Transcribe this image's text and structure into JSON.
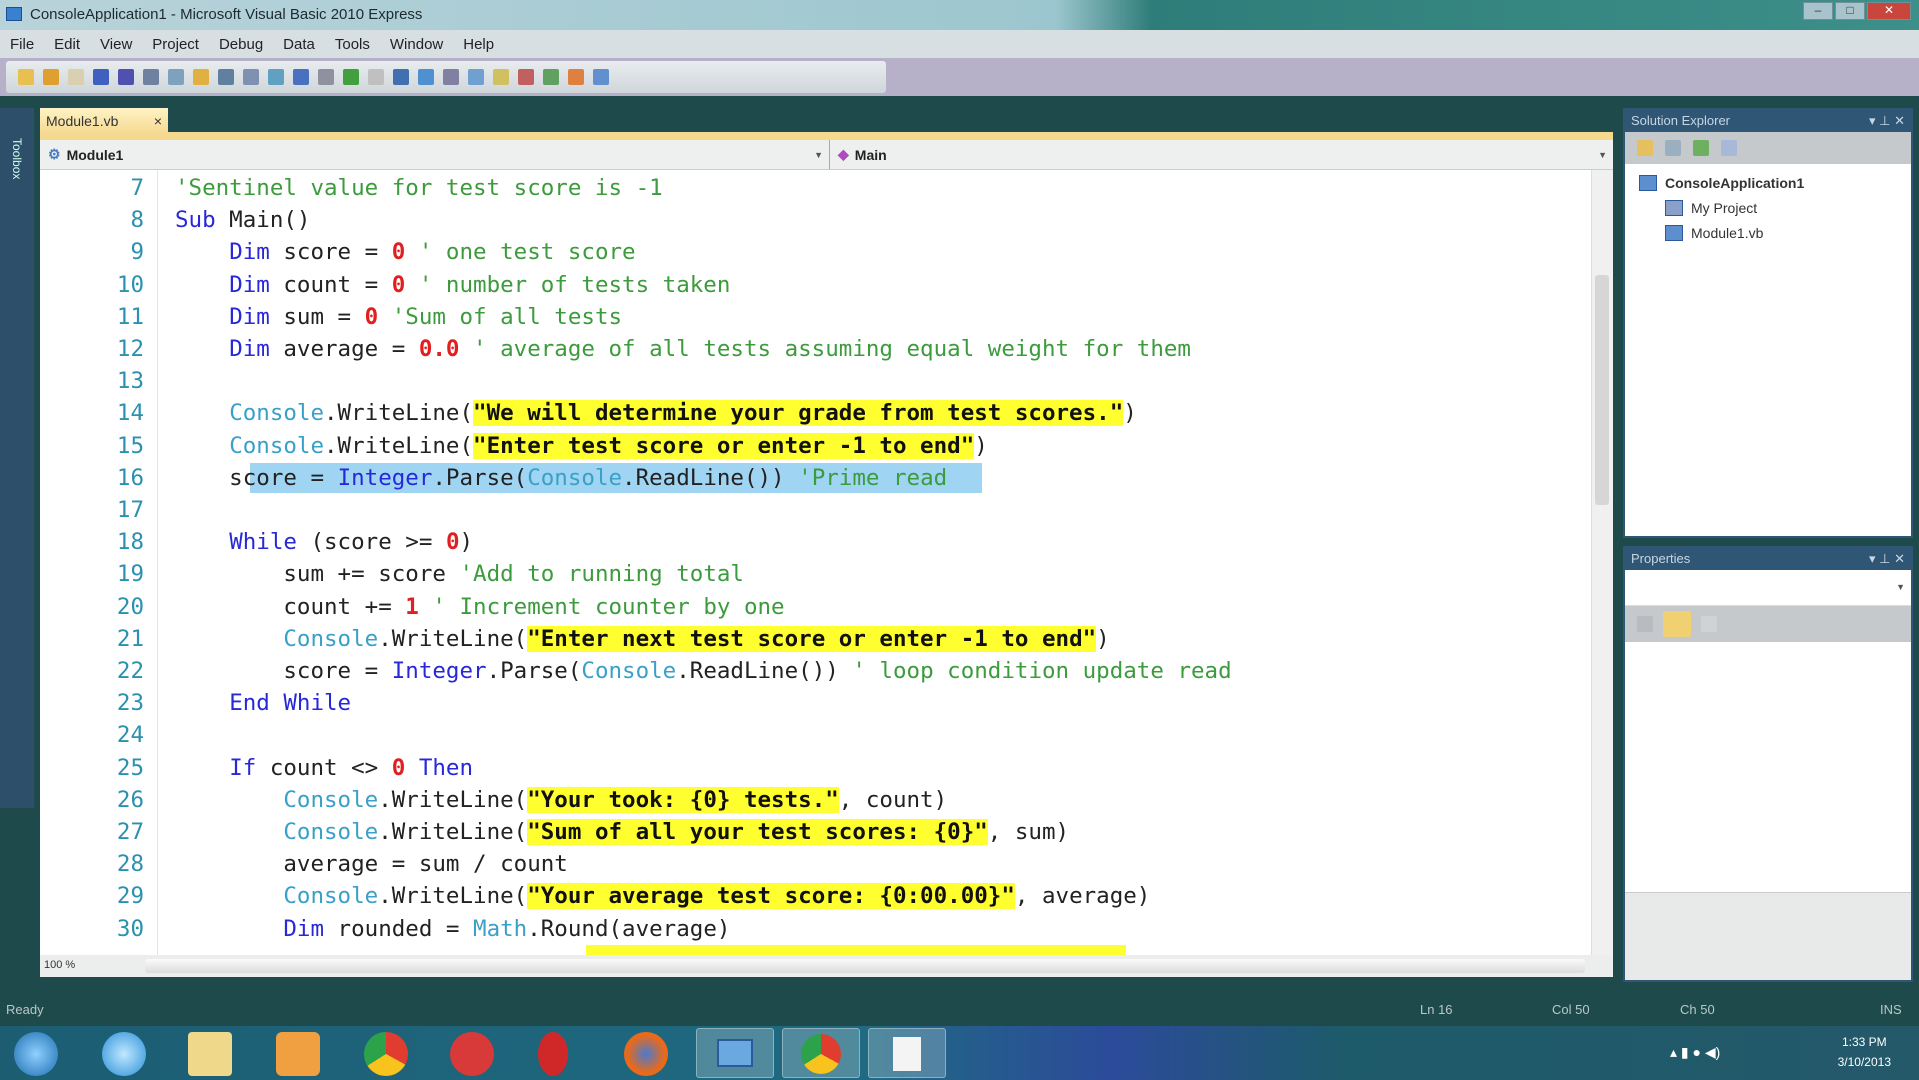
{
  "window": {
    "title": "ConsoleApplication1 - Microsoft Visual Basic 2010 Express"
  },
  "menu": [
    "File",
    "Edit",
    "View",
    "Project",
    "Debug",
    "Data",
    "Tools",
    "Window",
    "Help"
  ],
  "toolbox": {
    "label": "Toolbox"
  },
  "doc_tab": {
    "label": "Module1.vb",
    "close": "×"
  },
  "nav": {
    "left": "Module1",
    "right": "Main"
  },
  "editor": {
    "zoom": "100 %",
    "lines": [
      {
        "n": "7",
        "tokens": [
          [
            "cm",
            "'Sentinel value for test score is -1"
          ]
        ]
      },
      {
        "n": "8",
        "tokens": [
          [
            "kw",
            "Sub"
          ],
          [
            "pl",
            " Main()"
          ]
        ]
      },
      {
        "n": "9",
        "tokens": [
          [
            "pl",
            "    "
          ],
          [
            "kw",
            "Dim"
          ],
          [
            "pl",
            " score = "
          ],
          [
            "num",
            "0"
          ],
          [
            "cm",
            " ' one test score"
          ]
        ]
      },
      {
        "n": "10",
        "tokens": [
          [
            "pl",
            "    "
          ],
          [
            "kw",
            "Dim"
          ],
          [
            "pl",
            " count = "
          ],
          [
            "num",
            "0"
          ],
          [
            "cm",
            " ' number of tests taken"
          ]
        ]
      },
      {
        "n": "11",
        "tokens": [
          [
            "pl",
            "    "
          ],
          [
            "kw",
            "Dim"
          ],
          [
            "pl",
            " sum = "
          ],
          [
            "num",
            "0"
          ],
          [
            "cm",
            " 'Sum of all tests"
          ]
        ]
      },
      {
        "n": "12",
        "tokens": [
          [
            "pl",
            "    "
          ],
          [
            "kw",
            "Dim"
          ],
          [
            "pl",
            " average = "
          ],
          [
            "num",
            "0.0"
          ],
          [
            "cm",
            " ' average of all tests assuming equal weight for them"
          ]
        ]
      },
      {
        "n": "13",
        "tokens": []
      },
      {
        "n": "14",
        "tokens": [
          [
            "pl",
            "    "
          ],
          [
            "cls",
            "Console"
          ],
          [
            "pl",
            ".WriteLine("
          ],
          [
            "str",
            "\"We will determine your grade from test scores.\""
          ],
          [
            "pl",
            ")"
          ]
        ]
      },
      {
        "n": "15",
        "tokens": [
          [
            "pl",
            "    "
          ],
          [
            "cls",
            "Console"
          ],
          [
            "pl",
            ".WriteLine("
          ],
          [
            "str",
            "\"Enter test score or enter -1 to end\""
          ],
          [
            "pl",
            ")"
          ]
        ]
      },
      {
        "n": "16",
        "tokens": [
          [
            "pl",
            "    score = "
          ],
          [
            "kw",
            "Integer"
          ],
          [
            "pl",
            ".Parse("
          ],
          [
            "cls",
            "Console"
          ],
          [
            "pl",
            ".ReadLine())"
          ],
          [
            "cm",
            " 'Prime read"
          ]
        ]
      },
      {
        "n": "17",
        "tokens": []
      },
      {
        "n": "18",
        "tokens": [
          [
            "pl",
            "    "
          ],
          [
            "kw",
            "While"
          ],
          [
            "pl",
            " (score >= "
          ],
          [
            "num",
            "0"
          ],
          [
            "pl",
            ")"
          ]
        ]
      },
      {
        "n": "19",
        "tokens": [
          [
            "pl",
            "        sum += score"
          ],
          [
            "cm",
            " 'Add to running total"
          ]
        ]
      },
      {
        "n": "20",
        "tokens": [
          [
            "pl",
            "        count += "
          ],
          [
            "num",
            "1"
          ],
          [
            "cm",
            " ' Increment counter by one"
          ]
        ]
      },
      {
        "n": "21",
        "tokens": [
          [
            "pl",
            "        "
          ],
          [
            "cls",
            "Console"
          ],
          [
            "pl",
            ".WriteLine("
          ],
          [
            "str",
            "\"Enter next test score or enter -1 to end\""
          ],
          [
            "pl",
            ")"
          ]
        ]
      },
      {
        "n": "22",
        "tokens": [
          [
            "pl",
            "        score = "
          ],
          [
            "kw",
            "Integer"
          ],
          [
            "pl",
            ".Parse("
          ],
          [
            "cls",
            "Console"
          ],
          [
            "pl",
            ".ReadLine())"
          ],
          [
            "cm",
            " ' loop condition update read"
          ]
        ]
      },
      {
        "n": "23",
        "tokens": [
          [
            "pl",
            "    "
          ],
          [
            "kw",
            "End While"
          ]
        ]
      },
      {
        "n": "24",
        "tokens": []
      },
      {
        "n": "25",
        "tokens": [
          [
            "pl",
            "    "
          ],
          [
            "kw",
            "If"
          ],
          [
            "pl",
            " count <> "
          ],
          [
            "num",
            "0"
          ],
          [
            "kw",
            " Then"
          ]
        ]
      },
      {
        "n": "26",
        "tokens": [
          [
            "pl",
            "        "
          ],
          [
            "cls",
            "Console"
          ],
          [
            "pl",
            ".WriteLine("
          ],
          [
            "str",
            "\"Your took: {0} tests.\""
          ],
          [
            "pl",
            ", count)"
          ]
        ]
      },
      {
        "n": "27",
        "tokens": [
          [
            "pl",
            "        "
          ],
          [
            "cls",
            "Console"
          ],
          [
            "pl",
            ".WriteLine("
          ],
          [
            "str",
            "\"Sum of all your test scores: {0}\""
          ],
          [
            "pl",
            ", sum)"
          ]
        ]
      },
      {
        "n": "28",
        "tokens": [
          [
            "pl",
            "        average = sum / count"
          ]
        ]
      },
      {
        "n": "29",
        "tokens": [
          [
            "pl",
            "        "
          ],
          [
            "cls",
            "Console"
          ],
          [
            "pl",
            ".WriteLine("
          ],
          [
            "str",
            "\"Your average test score: {0:00.00}\""
          ],
          [
            "pl",
            ", average)"
          ]
        ]
      },
      {
        "n": "30",
        "tokens": [
          [
            "pl",
            "        "
          ],
          [
            "kw",
            "Dim"
          ],
          [
            "pl",
            " rounded = "
          ],
          [
            "cls",
            "Math"
          ],
          [
            "pl",
            ".Round(average)"
          ]
        ]
      }
    ]
  },
  "solution_explorer": {
    "title": "Solution Explorer",
    "items": [
      "ConsoleApplication1",
      "My Project",
      "Module1.vb"
    ]
  },
  "properties": {
    "title": "Properties"
  },
  "status": {
    "state": "Ready",
    "ln": "Ln 16",
    "col": "Col 50",
    "ch": "Ch 50",
    "mode": "INS"
  },
  "clock": {
    "time": "1:33 PM",
    "date": "3/10/2013"
  },
  "colors": {
    "keyword": "#2828d8",
    "comment": "#3c9b3c",
    "string_highlight": "#ffff30",
    "number": "#e02020",
    "type": "#3aa0c8"
  }
}
